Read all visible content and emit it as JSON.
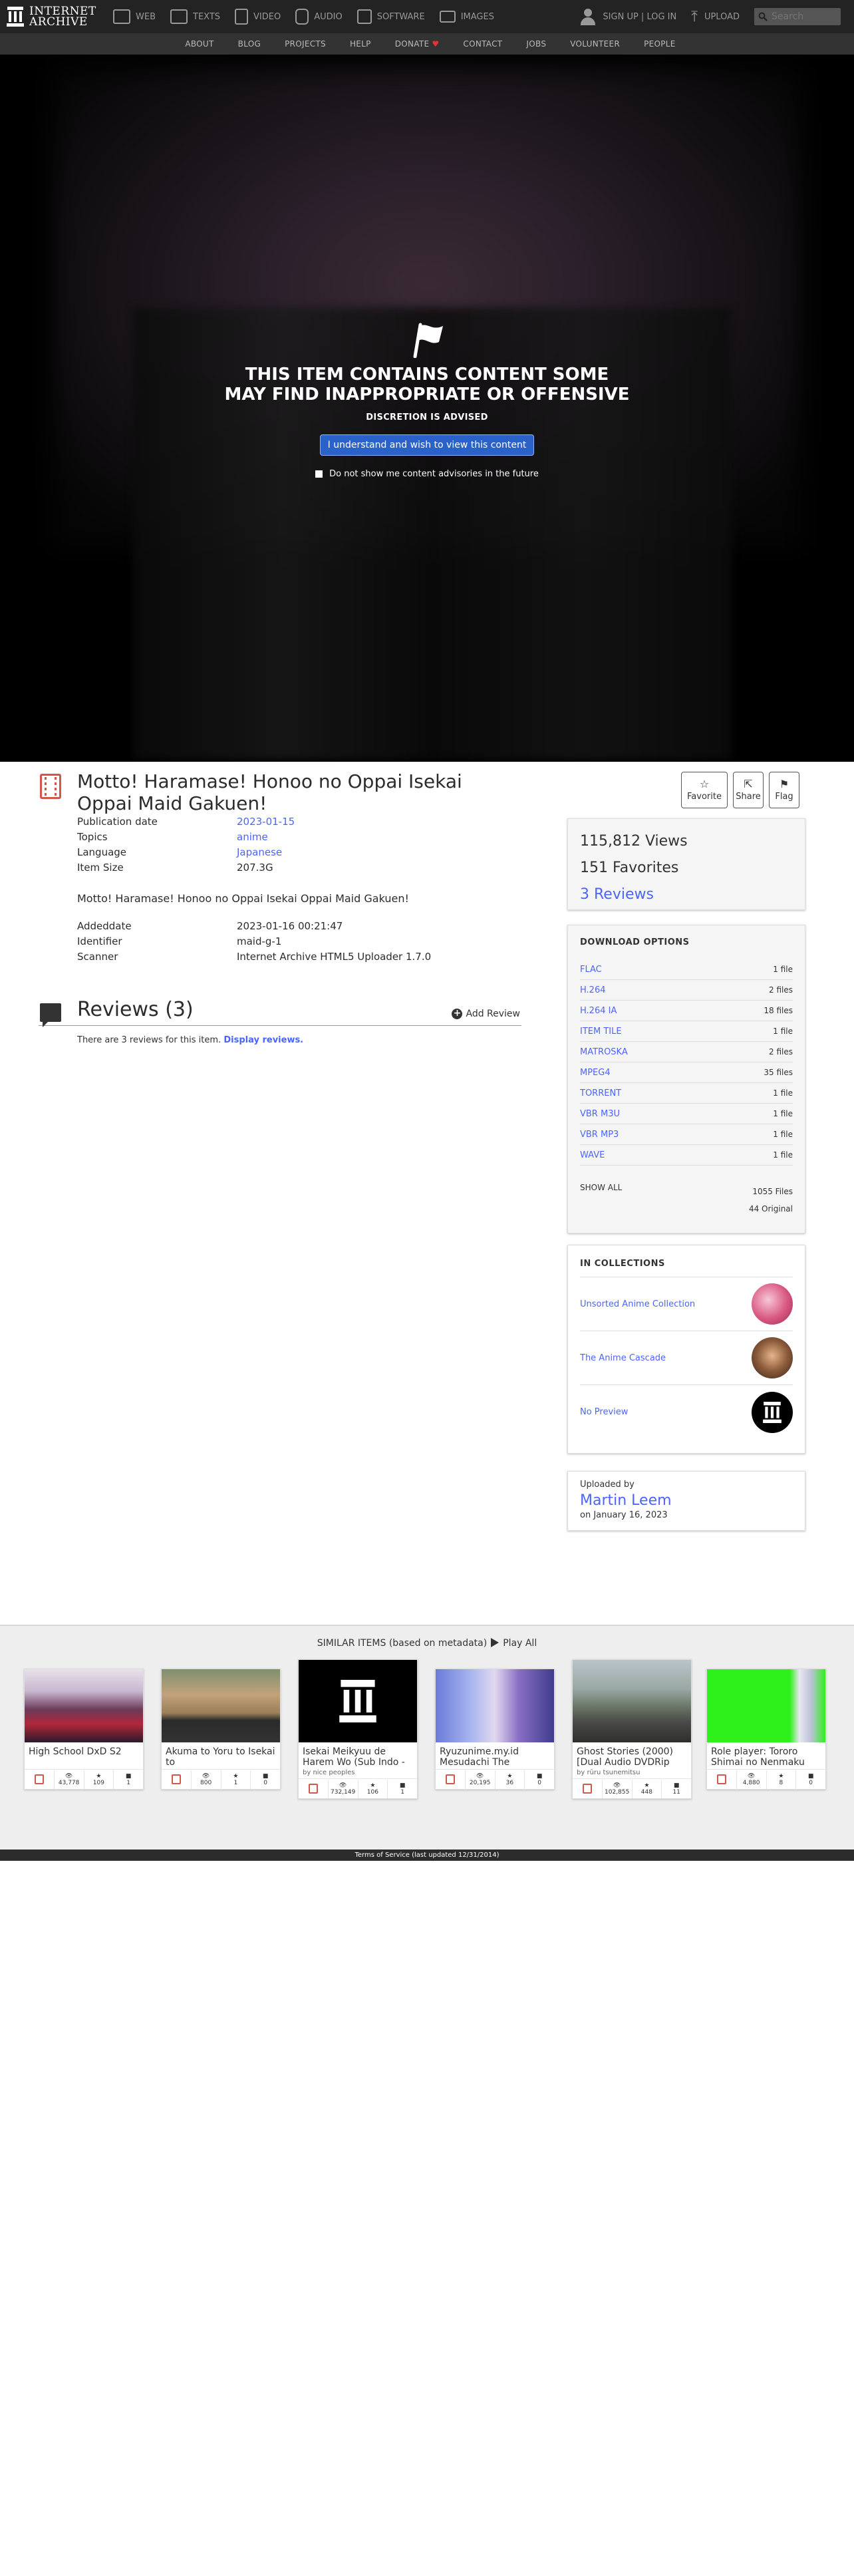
{
  "nav": {
    "logo_line1": "INTERNET",
    "logo_line2": "ARCHIVE",
    "media": [
      "WEB",
      "TEXTS",
      "VIDEO",
      "AUDIO",
      "SOFTWARE",
      "IMAGES"
    ],
    "signup": "SIGN UP | LOG IN",
    "upload": "UPLOAD",
    "search_placeholder": "Search"
  },
  "subnav": [
    "ABOUT",
    "BLOG",
    "PROJECTS",
    "HELP",
    "DONATE",
    "CONTACT",
    "JOBS",
    "VOLUNTEER",
    "PEOPLE"
  ],
  "advisory": {
    "title_line1": "THIS ITEM CONTAINS CONTENT SOME",
    "title_line2": "MAY FIND INAPPROPRIATE OR OFFENSIVE",
    "subtitle": "DISCRETION IS ADVISED",
    "button": "I understand and wish to view this content",
    "checkbox": "Do not show me content advisories in the future"
  },
  "item": {
    "title": "Motto! Haramase! Honoo no Oppai Isekai Oppai Maid Gakuen!",
    "actions": [
      "Favorite",
      "Share",
      "Flag"
    ],
    "metadata": [
      {
        "key": "Publication date",
        "value": "2023-01-15"
      },
      {
        "key": "Topics",
        "value": "anime"
      },
      {
        "key": "Language",
        "value": "Japanese"
      },
      {
        "key": "Item Size",
        "value": "207.3G"
      }
    ],
    "description": "Motto! Haramase! Honoo no Oppai Isekai Oppai Maid Gakuen!",
    "metadata2": [
      {
        "key": "Addeddate",
        "value": "2023-01-16 00:21:47"
      },
      {
        "key": "Identifier",
        "value": "maid-g-1"
      },
      {
        "key": "Scanner",
        "value": "Internet Archive HTML5 Uploader 1.7.0"
      }
    ]
  },
  "reviews": {
    "title": "Reviews (3)",
    "add": "Add Review",
    "text": "There are 3 reviews for this item.",
    "link": "Display reviews."
  },
  "stats": {
    "views": "115,812 Views",
    "favorites": "151 Favorites",
    "reviews": "3 Reviews"
  },
  "downloads": {
    "heading": "DOWNLOAD OPTIONS",
    "rows": [
      {
        "fmt": "FLAC",
        "cnt": "1 file"
      },
      {
        "fmt": "H.264",
        "cnt": "2 files"
      },
      {
        "fmt": "H.264 IA",
        "cnt": "18 files"
      },
      {
        "fmt": "ITEM TILE",
        "cnt": "1 file"
      },
      {
        "fmt": "MATROSKA",
        "cnt": "2 files"
      },
      {
        "fmt": "MPEG4",
        "cnt": "35 files"
      },
      {
        "fmt": "TORRENT",
        "cnt": "1 file"
      },
      {
        "fmt": "VBR M3U",
        "cnt": "1 file"
      },
      {
        "fmt": "VBR MP3",
        "cnt": "1 file"
      },
      {
        "fmt": "WAVE",
        "cnt": "1 file"
      }
    ],
    "show_all": "SHOW ALL",
    "total_files": "1055 Files",
    "original": "44 Original"
  },
  "collections": {
    "heading": "IN COLLECTIONS",
    "items": [
      "Unsorted Anime Collection",
      "The Anime Cascade",
      "No Preview"
    ]
  },
  "uploader": {
    "label": "Uploaded by",
    "name": "Martin Leem",
    "date": "on January 16, 2023"
  },
  "similar": {
    "heading": "SIMILAR ITEMS (based on metadata)",
    "play": "Play All",
    "cards": [
      {
        "title": "High School DxD S2",
        "by": "",
        "views": "43,778",
        "favs": "109",
        "reviews": "1"
      },
      {
        "title": "Akuma to Yoru to Isekai to",
        "by": "",
        "views": "800",
        "favs": "1",
        "reviews": "0"
      },
      {
        "title": "Isekai Meikyuu de Harem Wo (Sub Indo -",
        "by": "by nice peoples",
        "views": "732,149",
        "favs": "106",
        "reviews": "1"
      },
      {
        "title": "Ryuzunime.my.id Mesudachi The",
        "by": "",
        "views": "20,195",
        "favs": "36",
        "reviews": "0"
      },
      {
        "title": "Ghost Stories (2000) [Dual Audio DVDRip",
        "by": "by rūru tsunemitsu",
        "views": "102,855",
        "favs": "448",
        "reviews": "11"
      },
      {
        "title": "Role player: Tororo Shimai no Nenmaku",
        "by": "",
        "views": "4,880",
        "favs": "8",
        "reviews": "0"
      }
    ]
  },
  "footer": "Terms of Service (last updated 12/31/2014)",
  "colors": {
    "accent": "#4b64ff",
    "video": "#d0584b",
    "nav": "#232323"
  }
}
